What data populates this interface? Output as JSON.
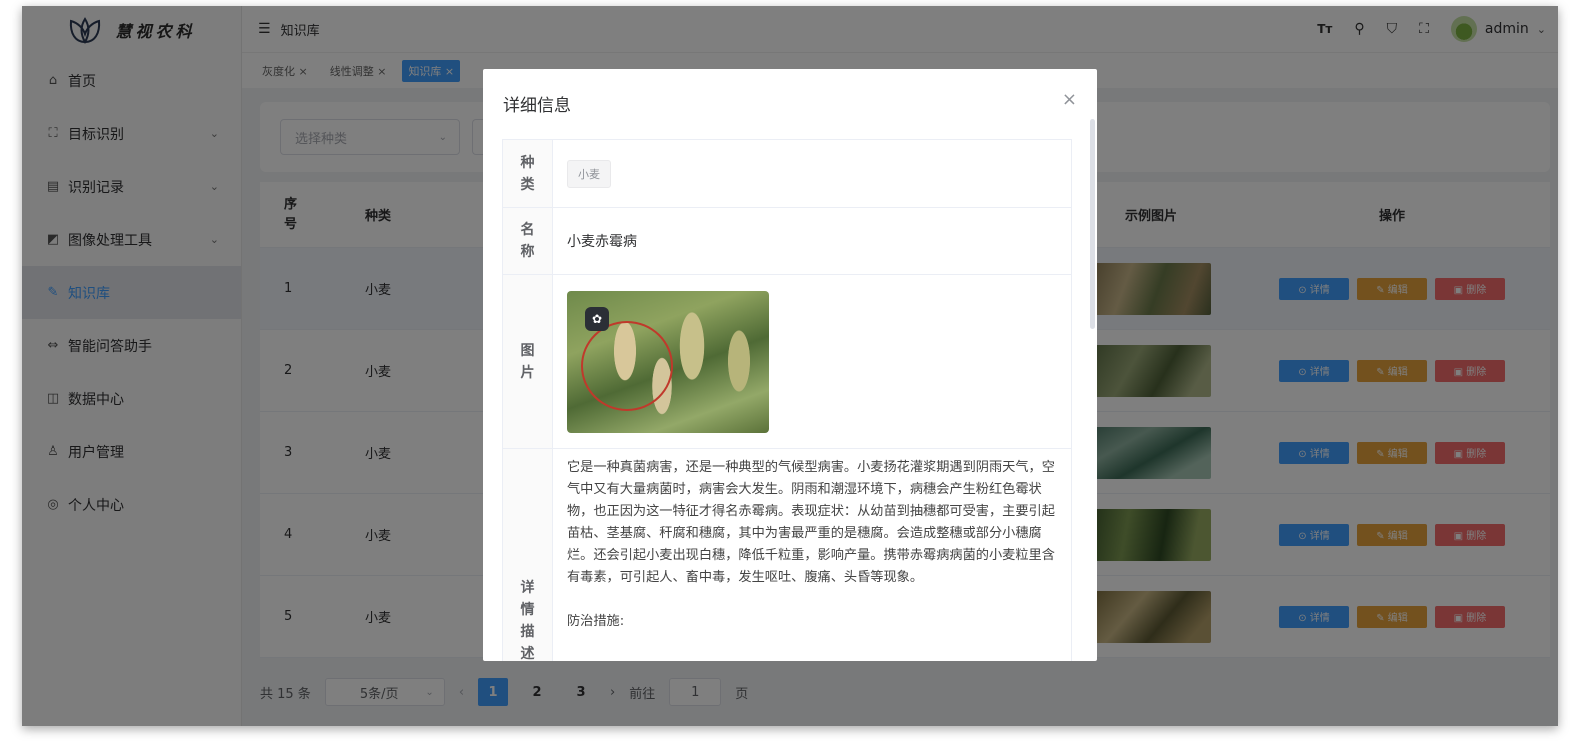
{
  "app": {
    "logo_text": "慧视农科"
  },
  "sidebar": {
    "items": [
      {
        "label": "首页",
        "icon": "home-icon",
        "glyph": "⌂"
      },
      {
        "label": "目标识别",
        "icon": "target-icon",
        "glyph": "⛶",
        "arrow": "⌄"
      },
      {
        "label": "识别记录",
        "icon": "record-icon",
        "glyph": "▤",
        "arrow": "⌄"
      },
      {
        "label": "图像处理工具",
        "icon": "image-tool-icon",
        "glyph": "◩",
        "arrow": "⌄"
      },
      {
        "label": "知识库",
        "icon": "knowledge-icon",
        "glyph": "✎"
      },
      {
        "label": "智能问答助手",
        "icon": "chat-icon",
        "glyph": "⇔"
      },
      {
        "label": "数据中心",
        "icon": "data-icon",
        "glyph": "◫"
      },
      {
        "label": "用户管理",
        "icon": "user-icon",
        "glyph": "♙"
      },
      {
        "label": "个人中心",
        "icon": "profile-icon",
        "glyph": "◎"
      }
    ]
  },
  "header": {
    "breadcrumb": "知识库",
    "username": "admin",
    "user_caret": "⌄",
    "icons": [
      "font-size-icon",
      "search-icon",
      "theme-icon",
      "fullscreen-icon"
    ]
  },
  "tags": [
    "灰度化 ×",
    "线性调整 ×",
    "知识库 ×"
  ],
  "search": {
    "select_placeholder": "选择种类",
    "chevron": "⌄"
  },
  "table": {
    "headers": {
      "index": "序号",
      "kind": "种类",
      "image": "示例图片",
      "ops": "操作"
    },
    "rows": [
      {
        "index": "1",
        "kind": "小麦"
      },
      {
        "index": "2",
        "kind": "小麦"
      },
      {
        "index": "3",
        "kind": "小麦"
      },
      {
        "index": "4",
        "kind": "小麦"
      },
      {
        "index": "5",
        "kind": "小麦"
      }
    ],
    "ops": {
      "view": "⊙ 详情",
      "edit": "✎ 编辑",
      "delete": "▣ 删除"
    }
  },
  "pagination": {
    "total": "共 15 条",
    "page_size": "5条/页",
    "prev": "‹",
    "pages": [
      "1",
      "2",
      "3"
    ],
    "current": "1",
    "next": "›",
    "goto_label": "前往",
    "goto_value": "1",
    "goto_suffix": "页"
  },
  "dialog": {
    "title": "详细信息",
    "close": "×",
    "labels": {
      "kind": "种类",
      "name": "名称",
      "image": "图片",
      "detail": "详情描述"
    },
    "kind_value": "小麦",
    "name_value": "小麦赤霉病",
    "image_badge": "✿",
    "detail_text": "它是一种真菌病害，还是一种典型的气候型病害。小麦扬花灌浆期遇到阴雨天气，空气中又有大量病菌时，病害会大发生。阴雨和潮湿环境下，病穗会产生粉红色霉状物，也正因为这一特征才得名赤霉病。表现症状：从幼苗到抽穗都可受害，主要引起苗枯、茎基腐、秆腐和穗腐，其中为害最严重的是穗腐。会造成整穗或部分小穗腐烂。还会引起小麦出现白穗，降低千粒重，影响产量。携带赤霉病病菌的小麦粒里含有毒素，可引起人、畜中毒，发生呕吐、腹痛、头昏等现象。",
    "prevention_label": "防治措施:"
  }
}
